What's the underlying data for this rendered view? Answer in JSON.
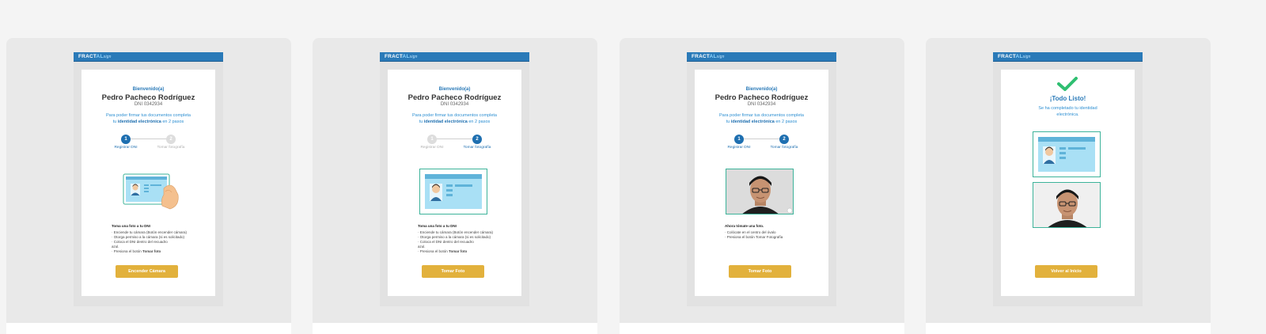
{
  "brand": {
    "logo_main": "FRACT",
    "logo_slash": "AL",
    "logo_sub": "sign"
  },
  "user": {
    "welcome": "Bienvenido(a)",
    "name": "Pedro Pacheco Rodríguez",
    "dni": "DNI 0342934"
  },
  "intro": {
    "line1": "Para poder firmar tus documentos completa",
    "pre": "tu ",
    "bold": "identidad electrónica",
    "post": " en 2 pasos"
  },
  "steps": [
    {
      "number": "1",
      "label": "Registrar DNI"
    },
    {
      "number": "2",
      "label": "Tomar fotografía"
    }
  ],
  "screen1": {
    "instr_title": "Toma una foto a tu DNI",
    "instr_lines": [
      "· Enciende tu cámara (Botón encender cámara)",
      "· Otorga permiso a la cámara (si es solicitado)",
      "· Coloca el DNI dentro del recuadro",
      "  azul.",
      "· Presiona el botón "
    ],
    "instr_bold": "Tomar foto",
    "button": "Encender Cámara"
  },
  "screen2": {
    "instr_title": "Toma una foto a tu DNI",
    "instr_lines": [
      "· Enciende tu cámara (Botón encender cámara)",
      "· Otorga permiso a la cámara (si es solicitado)",
      "· Coloca el DNI dentro del recuadro",
      "  azul.",
      "· Presiona el botón "
    ],
    "instr_bold": "Tomar foto",
    "button": "Tomar Foto"
  },
  "screen3": {
    "instr_title": "Ahora tómate una foto.",
    "instr_lines": [
      "· Colócate en el centro del óvalo",
      "· Presiona el botón Tomar Fotografía"
    ],
    "button": "Tomar Foto"
  },
  "screen4": {
    "title": "¡Todo Listo!",
    "message": "Se ha completado tu identidad electrónica.",
    "button": "Volver al Inicio"
  },
  "colors": {
    "primary": "#2a7ab8",
    "accent": "#e2b13c",
    "success": "#2fbf71",
    "frame": "#3db39a"
  }
}
